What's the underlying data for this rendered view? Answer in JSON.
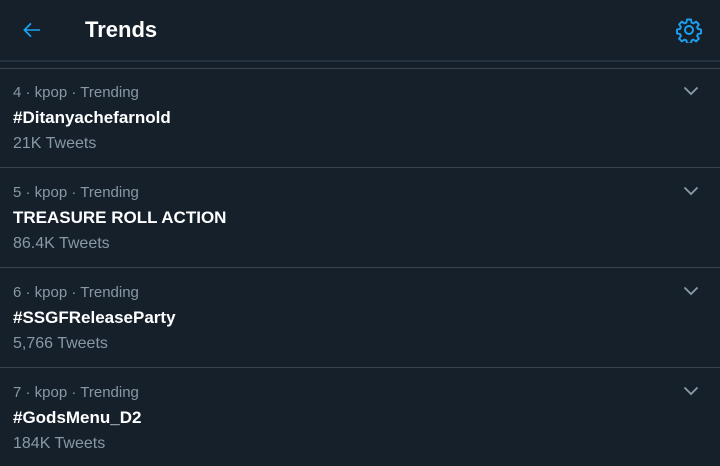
{
  "header": {
    "title": "Trends",
    "back_icon": "arrow-left-icon",
    "settings_icon": "gear-icon"
  },
  "colors": {
    "background": "#15202b",
    "accent": "#1da1f2",
    "secondary_text": "#8899a6",
    "divider": "#38444d"
  },
  "trends": [
    {
      "rank": "4",
      "category": "kpop",
      "status": "Trending",
      "meta": "4 · kpop · Trending",
      "name": "#Ditanyachefarnold",
      "count": "21K Tweets"
    },
    {
      "rank": "5",
      "category": "kpop",
      "status": "Trending",
      "meta": "5 · kpop · Trending",
      "name": "TREASURE ROLL ACTION",
      "count": "86.4K Tweets"
    },
    {
      "rank": "6",
      "category": "kpop",
      "status": "Trending",
      "meta": "6 · kpop · Trending",
      "name": "#SSGFReleaseParty",
      "count": "5,766 Tweets"
    },
    {
      "rank": "7",
      "category": "kpop",
      "status": "Trending",
      "meta": "7 · kpop · Trending",
      "name": "#GodsMenu_D2",
      "count": "184K Tweets"
    }
  ]
}
